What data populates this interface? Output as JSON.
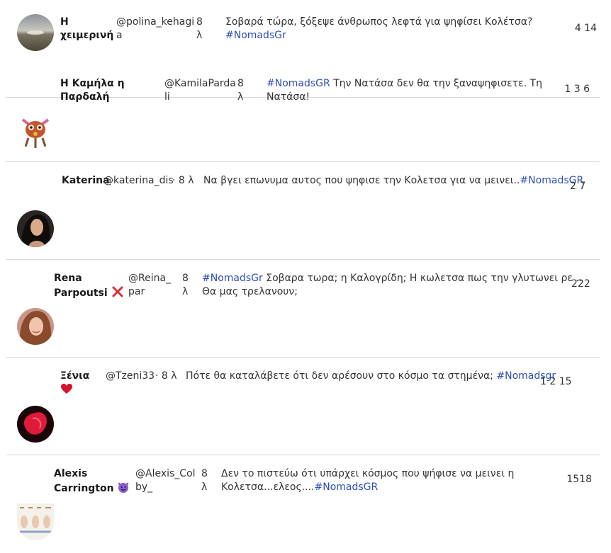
{
  "tweets": [
    {
      "name": "Η χειμερινή",
      "handle_l1": "@polina_kehagi",
      "handle_l2": "a",
      "time_num": "8",
      "time_unit": "λ",
      "text": "Σοβαρά τώρα, ξόξεψε άνθρωπος λεφτά για ψηφίσει Κολέτσα?",
      "hashtag": "#NomadsGr",
      "counts": "4 14"
    },
    {
      "name": "Η Καμήλα η Παρδαλή",
      "handle_l1": "@KamilaParda",
      "handle_l2": "li",
      "time_num": "8",
      "time_unit": "λ",
      "hashtag": "#NomadsGR",
      "text": "Την Νατάσα δεν θα την ξαναψηφισετε. Τη Νατάσα!",
      "counts": "1 3 6"
    },
    {
      "name": "Katerina",
      "handle": "@katerina_dis",
      "time": "· 8 λ",
      "text": "Να βγει επωνυμα αυτος που ψηφισε την Κολετσα για να μεινει..",
      "hashtag": "#NomadsGR",
      "counts": "2 7"
    },
    {
      "name": "Rena Parpoutsi",
      "name_emoji": "cross-mark-icon",
      "handle_l1": "@Reina_",
      "handle_l2": "par",
      "time_num": "8",
      "time_unit": "λ",
      "hashtag": "#NomadsGr",
      "text": "Σοβαρα τωρα; η Καλογρίδη; Η κωλετσα πως την γλυτωνει ρε ..",
      "text2": "Θα μας τρελανουν;",
      "counts": "222"
    },
    {
      "name": "Ξένια",
      "name_emoji": "red-heart-icon",
      "handle": "@Tzeni33",
      "time": "· 8 λ",
      "text": "Πότε θα καταλάβετε ότι δεν αρέσουν στο κόσμο τα στημένα;",
      "hashtag": "#Nomadsgr",
      "counts": "1 2 15"
    },
    {
      "name": "Alexis Carrington",
      "name_emoji": "smiling-devil-icon",
      "handle_l1": "@Alexis_Col",
      "handle_l2": "by_",
      "time_num": "8",
      "time_unit": "λ",
      "text": "Δεν το πιστεύω ότι υπάρχει κόσμος που ψήφισε να μεινει η",
      "text2": "Κολετσα...ελεος....",
      "hashtag": "#NomadsGR",
      "counts": "1518"
    }
  ]
}
